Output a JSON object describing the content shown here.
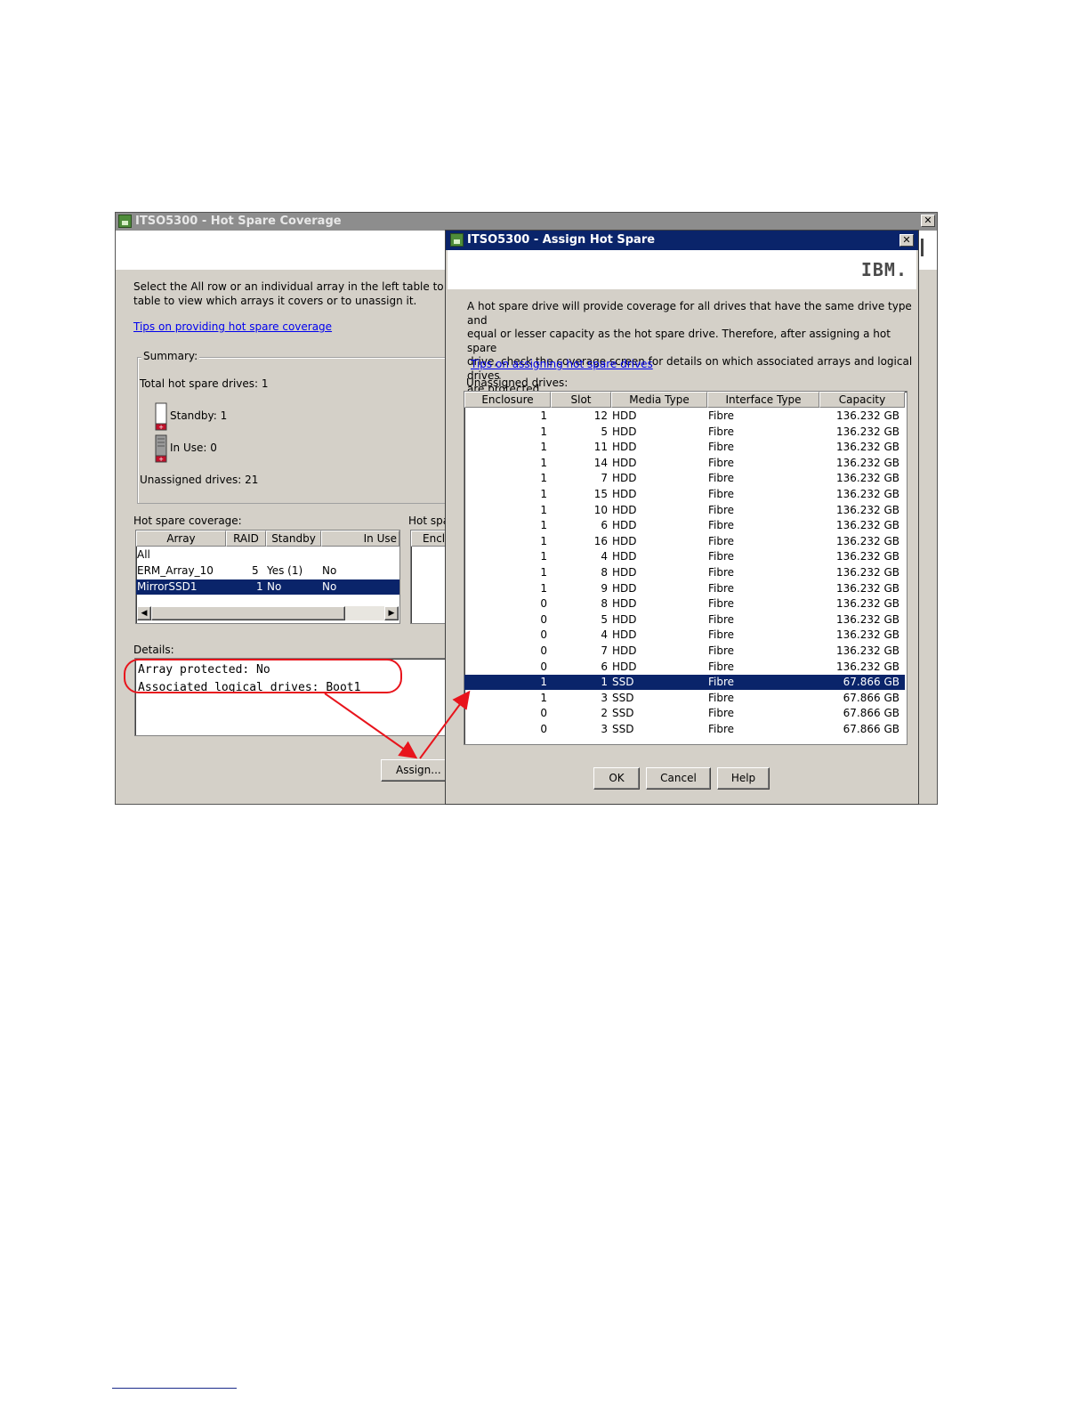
{
  "back_window": {
    "title": "ITSO5300 - Hot Spare Coverage",
    "instructions_line1": "Select the All row or an individual array in the left table to view cur",
    "instructions_line2": "table to view which arrays it covers or to unassign it.",
    "tips_link": "Tips on providing hot spare coverage",
    "summary": {
      "label": "Summary:",
      "total": "Total hot spare drives: 1",
      "standby": "Standby: 1",
      "in_use": "In Use: 0",
      "unassigned": "Unassigned drives: 21"
    },
    "coverage_label": "Hot spare coverage:",
    "coverage_table": {
      "columns": [
        "Array",
        "RAID",
        "Standby",
        "In Use"
      ],
      "rows": [
        [
          "All",
          "",
          "",
          ""
        ],
        [
          "ERM_Array_10",
          "5",
          "Yes (1)",
          "No"
        ],
        [
          "MirrorSSD1",
          "1",
          "No",
          "No"
        ]
      ]
    },
    "hot_spare_label": "Hot spa",
    "hot_spare_col": "Enclo",
    "details_label": "Details:",
    "details_line1": "Array protected: No",
    "details_line2": "Associated logical drives: Boot1",
    "assign_button": "Assign..."
  },
  "dialog": {
    "title": "ITSO5300 - Assign Hot Spare",
    "logo": "IBM.",
    "description": [
      "A hot spare drive will provide coverage for all drives that have the same drive type and",
      "equal or lesser capacity as the hot spare drive.  Therefore, after assigning a hot spare",
      "drive, check the coverage screen for details on which associated arrays and logical drives",
      "are protected."
    ],
    "tips_link": "Tips on assigning hot spare drives",
    "unassigned_label": "Unassigned drives:",
    "table": {
      "columns": [
        "Enclosure",
        "Slot",
        "Media Type",
        "Interface Type",
        "Capacity"
      ],
      "rows": [
        [
          "1",
          "12",
          "HDD",
          "Fibre",
          "136.232 GB"
        ],
        [
          "1",
          "5",
          "HDD",
          "Fibre",
          "136.232 GB"
        ],
        [
          "1",
          "11",
          "HDD",
          "Fibre",
          "136.232 GB"
        ],
        [
          "1",
          "14",
          "HDD",
          "Fibre",
          "136.232 GB"
        ],
        [
          "1",
          "7",
          "HDD",
          "Fibre",
          "136.232 GB"
        ],
        [
          "1",
          "15",
          "HDD",
          "Fibre",
          "136.232 GB"
        ],
        [
          "1",
          "10",
          "HDD",
          "Fibre",
          "136.232 GB"
        ],
        [
          "1",
          "6",
          "HDD",
          "Fibre",
          "136.232 GB"
        ],
        [
          "1",
          "16",
          "HDD",
          "Fibre",
          "136.232 GB"
        ],
        [
          "1",
          "4",
          "HDD",
          "Fibre",
          "136.232 GB"
        ],
        [
          "1",
          "8",
          "HDD",
          "Fibre",
          "136.232 GB"
        ],
        [
          "1",
          "9",
          "HDD",
          "Fibre",
          "136.232 GB"
        ],
        [
          "0",
          "8",
          "HDD",
          "Fibre",
          "136.232 GB"
        ],
        [
          "0",
          "5",
          "HDD",
          "Fibre",
          "136.232 GB"
        ],
        [
          "0",
          "4",
          "HDD",
          "Fibre",
          "136.232 GB"
        ],
        [
          "0",
          "7",
          "HDD",
          "Fibre",
          "136.232 GB"
        ],
        [
          "0",
          "6",
          "HDD",
          "Fibre",
          "136.232 GB"
        ],
        [
          "1",
          "1",
          "SSD",
          "Fibre",
          "67.866 GB"
        ],
        [
          "1",
          "3",
          "SSD",
          "Fibre",
          "67.866 GB"
        ],
        [
          "0",
          "2",
          "SSD",
          "Fibre",
          "67.866 GB"
        ],
        [
          "0",
          "3",
          "SSD",
          "Fibre",
          "67.866 GB"
        ]
      ],
      "selected_row": 17
    },
    "ok_button": "OK",
    "cancel_button": "Cancel",
    "help_button": "Help"
  },
  "colors": {
    "selection": "#0a246a",
    "annotation": "#e8141c",
    "link": "#0000ee"
  }
}
